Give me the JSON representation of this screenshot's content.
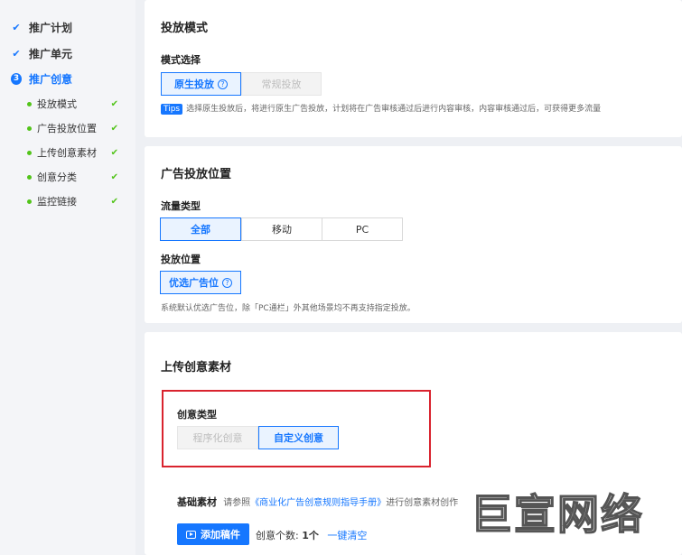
{
  "sidebar": {
    "steps": [
      {
        "label": "推广计划",
        "status": "done"
      },
      {
        "label": "推广单元",
        "status": "done"
      },
      {
        "label": "推广创意",
        "status": "active",
        "number": "3"
      }
    ],
    "substeps": [
      {
        "label": "投放模式"
      },
      {
        "label": "广告投放位置"
      },
      {
        "label": "上传创意素材"
      },
      {
        "label": "创意分类"
      },
      {
        "label": "监控链接"
      }
    ]
  },
  "mode_section": {
    "title": "投放模式",
    "field_label": "模式选择",
    "options": [
      "原生投放",
      "常规投放"
    ],
    "selected": "原生投放",
    "tips_badge": "Tips",
    "tips_text": "选择原生投放后，将进行原生广告投放，计划将在广告审核通过后进行内容审核，内容审核通过后，可获得更多流量"
  },
  "placement_section": {
    "title": "广告投放位置",
    "traffic_label": "流量类型",
    "traffic_options": [
      "全部",
      "移动",
      "PC"
    ],
    "traffic_selected": "全部",
    "position_label": "投放位置",
    "position_button": "优选广告位",
    "hint": "系统默认优选广告位，除「PC通栏」外其他场景均不再支持指定投放。"
  },
  "creative_section": {
    "title": "上传创意素材",
    "type_label": "创意类型",
    "type_options": [
      "程序化创意",
      "自定义创意"
    ],
    "type_selected": "自定义创意",
    "base_label": "基础素材",
    "base_hint_prefix": "请参照",
    "base_hint_link": "《商业化广告创意规则指导手册》",
    "base_hint_suffix": "进行创意素材创作",
    "add_button": "添加稿件",
    "count_label": "创意个数:",
    "count_value": "1个",
    "clear_link": "一键清空"
  },
  "watermark": "巨宣网络",
  "colors": {
    "accent": "#1677ff",
    "success": "#52c41a",
    "highlight_box": "#d9232e"
  }
}
